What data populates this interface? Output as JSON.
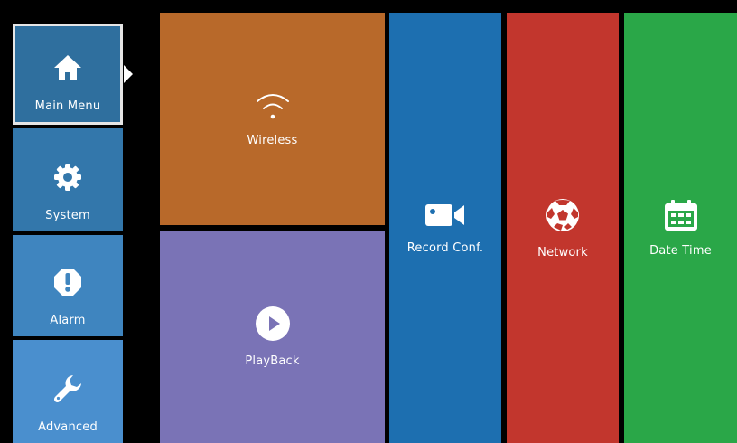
{
  "sidebar": {
    "items": [
      {
        "label": "Main Menu",
        "icon": "home-icon",
        "selected": true
      },
      {
        "label": "System",
        "icon": "gear-icon"
      },
      {
        "label": "Alarm",
        "icon": "alert-octagon-icon"
      },
      {
        "label": "Advanced",
        "icon": "wrench-icon"
      }
    ]
  },
  "tiles": {
    "wireless": {
      "label": "Wireless",
      "icon": "wifi-icon",
      "color": "#b8692a"
    },
    "playback": {
      "label": "PlayBack",
      "icon": "play-circle-icon",
      "color": "#7a73b6"
    },
    "record": {
      "label": "Record Conf.",
      "icon": "video-camera-icon",
      "color": "#1d6fb0"
    },
    "network": {
      "label": "Network",
      "icon": "network-ball-icon",
      "color": "#c2362d"
    },
    "datetime": {
      "label": "Date Time",
      "icon": "calendar-icon",
      "color": "#2aa748"
    }
  }
}
